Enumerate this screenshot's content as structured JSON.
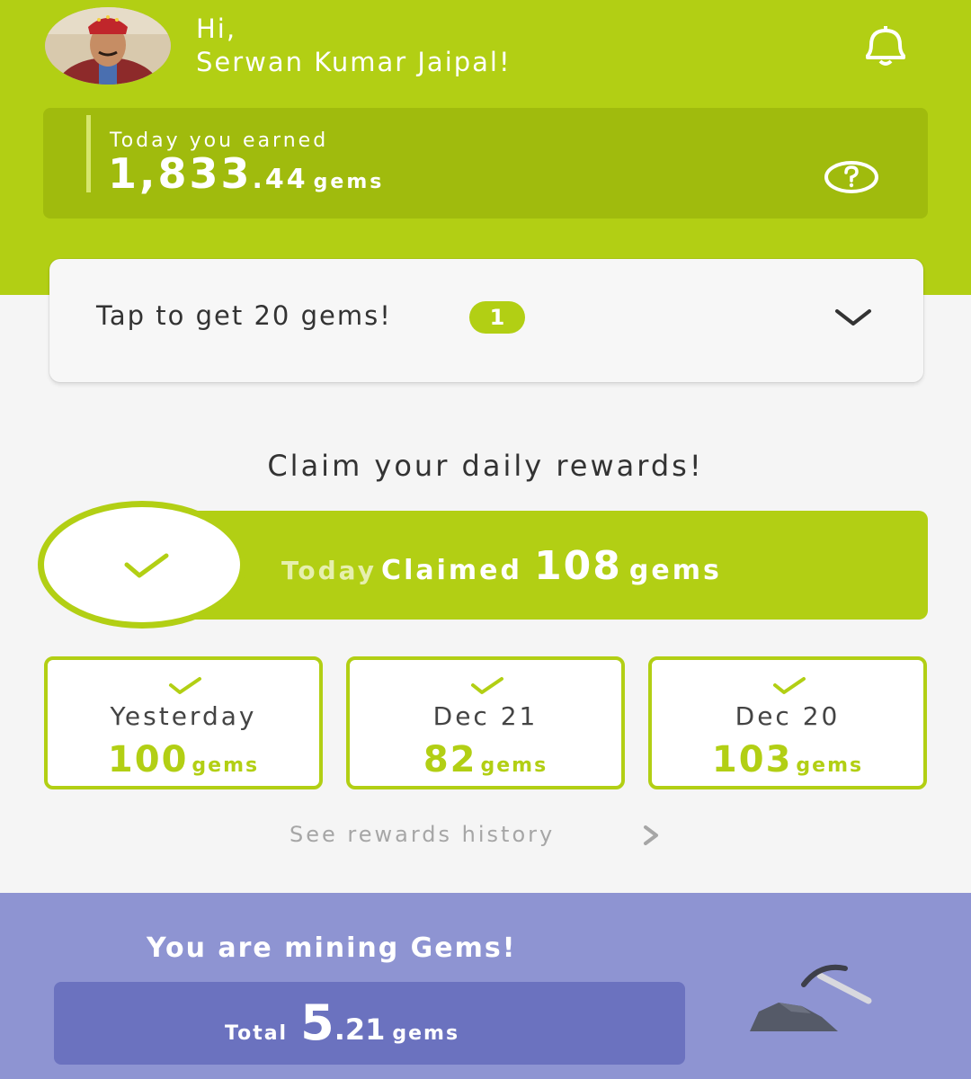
{
  "header": {
    "greeting_line1": "Hi,",
    "greeting_line2": "Serwan Kumar Jaipal!",
    "notification_icon": "bell-icon"
  },
  "earnings": {
    "label": "Today you earned",
    "value_whole": "1,833",
    "value_decimal": ".44",
    "unit": "gems",
    "help_icon": "question-circle-icon"
  },
  "tap_card": {
    "text": "Tap to get 20 gems!",
    "badge": "1",
    "expand_icon": "chevron-down-icon"
  },
  "daily_rewards": {
    "title": "Claim your daily rewards!",
    "today": {
      "label": "Today",
      "status": "Claimed",
      "amount": "108",
      "unit": "gems"
    },
    "previous": [
      {
        "day": "Yesterday",
        "amount": "100",
        "unit": "gems"
      },
      {
        "day": "Dec 21",
        "amount": "82",
        "unit": "gems"
      },
      {
        "day": "Dec 20",
        "amount": "103",
        "unit": "gems"
      }
    ],
    "history_link": "See rewards history"
  },
  "mining": {
    "title": "You are mining Gems!",
    "total_label": "Total",
    "total_whole": "5",
    "total_decimal": ".21",
    "unit": "gems",
    "icon": "pickaxe-icon"
  },
  "colors": {
    "brand_green": "#b2cf14",
    "dark_green": "#a0bb0d",
    "mining_purple": "#8e94d2",
    "mining_box": "#6b72bf"
  }
}
